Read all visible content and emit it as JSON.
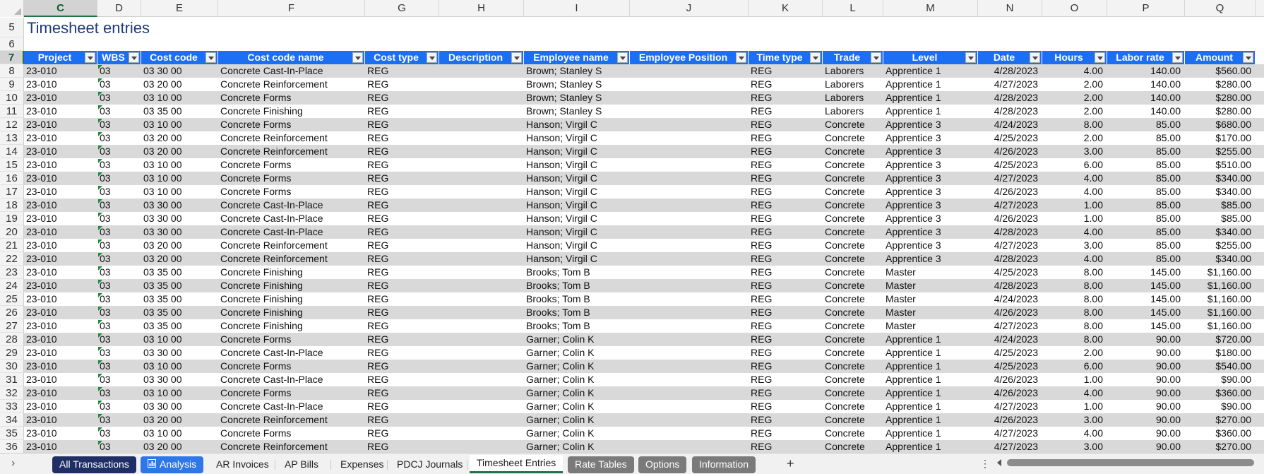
{
  "sheet": {
    "title": "Timesheet entries",
    "columns": [
      {
        "letter": "C",
        "selected": true
      },
      {
        "letter": "D"
      },
      {
        "letter": "E"
      },
      {
        "letter": "F"
      },
      {
        "letter": "G"
      },
      {
        "letter": "H"
      },
      {
        "letter": "I"
      },
      {
        "letter": "J"
      },
      {
        "letter": "K"
      },
      {
        "letter": "L"
      },
      {
        "letter": "M"
      },
      {
        "letter": "N"
      },
      {
        "letter": "O"
      },
      {
        "letter": "P"
      },
      {
        "letter": "Q"
      }
    ],
    "row_numbers_top": [
      "5",
      "6",
      "7"
    ],
    "headers": [
      "Project",
      "WBS",
      "Cost code",
      "Cost code name",
      "Cost type",
      "Description",
      "Employee name",
      "Employee Position",
      "Time type",
      "Trade",
      "Level",
      "Date",
      "Hours",
      "Labor rate",
      "Amount"
    ],
    "rows": [
      {
        "n": "8",
        "cells": [
          "23-010",
          "03",
          "03 30 00",
          "Concrete Cast-In-Place",
          "REG",
          "",
          "Brown; Stanley S",
          "",
          "REG",
          "Laborers",
          "Apprentice 1",
          "4/28/2023",
          "4.00",
          "140.00",
          "$560.00"
        ]
      },
      {
        "n": "9",
        "cells": [
          "23-010",
          "03",
          "03 20 00",
          "Concrete Reinforcement",
          "REG",
          "",
          "Brown; Stanley S",
          "",
          "REG",
          "Laborers",
          "Apprentice 1",
          "4/27/2023",
          "2.00",
          "140.00",
          "$280.00"
        ]
      },
      {
        "n": "10",
        "cells": [
          "23-010",
          "03",
          "03 10 00",
          "Concrete Forms",
          "REG",
          "",
          "Brown; Stanley S",
          "",
          "REG",
          "Laborers",
          "Apprentice 1",
          "4/28/2023",
          "2.00",
          "140.00",
          "$280.00"
        ]
      },
      {
        "n": "11",
        "cells": [
          "23-010",
          "03",
          "03 35 00",
          "Concrete Finishing",
          "REG",
          "",
          "Brown; Stanley S",
          "",
          "REG",
          "Laborers",
          "Apprentice 1",
          "4/28/2023",
          "2.00",
          "140.00",
          "$280.00"
        ]
      },
      {
        "n": "12",
        "cells": [
          "23-010",
          "03",
          "03 10 00",
          "Concrete Forms",
          "REG",
          "",
          "Hanson; Virgil C",
          "",
          "REG",
          "Concrete",
          "Apprentice 3",
          "4/24/2023",
          "8.00",
          "85.00",
          "$680.00"
        ]
      },
      {
        "n": "13",
        "cells": [
          "23-010",
          "03",
          "03 20 00",
          "Concrete Reinforcement",
          "REG",
          "",
          "Hanson; Virgil C",
          "",
          "REG",
          "Concrete",
          "Apprentice 3",
          "4/25/2023",
          "2.00",
          "85.00",
          "$170.00"
        ]
      },
      {
        "n": "14",
        "cells": [
          "23-010",
          "03",
          "03 20 00",
          "Concrete Reinforcement",
          "REG",
          "",
          "Hanson; Virgil C",
          "",
          "REG",
          "Concrete",
          "Apprentice 3",
          "4/26/2023",
          "3.00",
          "85.00",
          "$255.00"
        ]
      },
      {
        "n": "15",
        "cells": [
          "23-010",
          "03",
          "03 10 00",
          "Concrete Forms",
          "REG",
          "",
          "Hanson; Virgil C",
          "",
          "REG",
          "Concrete",
          "Apprentice 3",
          "4/25/2023",
          "6.00",
          "85.00",
          "$510.00"
        ]
      },
      {
        "n": "16",
        "cells": [
          "23-010",
          "03",
          "03 10 00",
          "Concrete Forms",
          "REG",
          "",
          "Hanson; Virgil C",
          "",
          "REG",
          "Concrete",
          "Apprentice 3",
          "4/27/2023",
          "4.00",
          "85.00",
          "$340.00"
        ]
      },
      {
        "n": "17",
        "cells": [
          "23-010",
          "03",
          "03 10 00",
          "Concrete Forms",
          "REG",
          "",
          "Hanson; Virgil C",
          "",
          "REG",
          "Concrete",
          "Apprentice 3",
          "4/26/2023",
          "4.00",
          "85.00",
          "$340.00"
        ]
      },
      {
        "n": "18",
        "cells": [
          "23-010",
          "03",
          "03 30 00",
          "Concrete Cast-In-Place",
          "REG",
          "",
          "Hanson; Virgil C",
          "",
          "REG",
          "Concrete",
          "Apprentice 3",
          "4/27/2023",
          "1.00",
          "85.00",
          "$85.00"
        ]
      },
      {
        "n": "19",
        "cells": [
          "23-010",
          "03",
          "03 30 00",
          "Concrete Cast-In-Place",
          "REG",
          "",
          "Hanson; Virgil C",
          "",
          "REG",
          "Concrete",
          "Apprentice 3",
          "4/26/2023",
          "1.00",
          "85.00",
          "$85.00"
        ]
      },
      {
        "n": "20",
        "cells": [
          "23-010",
          "03",
          "03 30 00",
          "Concrete Cast-In-Place",
          "REG",
          "",
          "Hanson; Virgil C",
          "",
          "REG",
          "Concrete",
          "Apprentice 3",
          "4/28/2023",
          "4.00",
          "85.00",
          "$340.00"
        ]
      },
      {
        "n": "21",
        "cells": [
          "23-010",
          "03",
          "03 20 00",
          "Concrete Reinforcement",
          "REG",
          "",
          "Hanson; Virgil C",
          "",
          "REG",
          "Concrete",
          "Apprentice 3",
          "4/27/2023",
          "3.00",
          "85.00",
          "$255.00"
        ]
      },
      {
        "n": "22",
        "cells": [
          "23-010",
          "03",
          "03 20 00",
          "Concrete Reinforcement",
          "REG",
          "",
          "Hanson; Virgil C",
          "",
          "REG",
          "Concrete",
          "Apprentice 3",
          "4/28/2023",
          "4.00",
          "85.00",
          "$340.00"
        ]
      },
      {
        "n": "23",
        "cells": [
          "23-010",
          "03",
          "03 35 00",
          "Concrete Finishing",
          "REG",
          "",
          "Brooks; Tom B",
          "",
          "REG",
          "Concrete",
          "Master",
          "4/25/2023",
          "8.00",
          "145.00",
          "$1,160.00"
        ]
      },
      {
        "n": "24",
        "cells": [
          "23-010",
          "03",
          "03 35 00",
          "Concrete Finishing",
          "REG",
          "",
          "Brooks; Tom B",
          "",
          "REG",
          "Concrete",
          "Master",
          "4/28/2023",
          "8.00",
          "145.00",
          "$1,160.00"
        ]
      },
      {
        "n": "25",
        "cells": [
          "23-010",
          "03",
          "03 35 00",
          "Concrete Finishing",
          "REG",
          "",
          "Brooks; Tom B",
          "",
          "REG",
          "Concrete",
          "Master",
          "4/24/2023",
          "8.00",
          "145.00",
          "$1,160.00"
        ]
      },
      {
        "n": "26",
        "cells": [
          "23-010",
          "03",
          "03 35 00",
          "Concrete Finishing",
          "REG",
          "",
          "Brooks; Tom B",
          "",
          "REG",
          "Concrete",
          "Master",
          "4/26/2023",
          "8.00",
          "145.00",
          "$1,160.00"
        ]
      },
      {
        "n": "27",
        "cells": [
          "23-010",
          "03",
          "03 35 00",
          "Concrete Finishing",
          "REG",
          "",
          "Brooks; Tom B",
          "",
          "REG",
          "Concrete",
          "Master",
          "4/27/2023",
          "8.00",
          "145.00",
          "$1,160.00"
        ]
      },
      {
        "n": "28",
        "cells": [
          "23-010",
          "03",
          "03 10 00",
          "Concrete Forms",
          "REG",
          "",
          "Garner; Colin K",
          "",
          "REG",
          "Concrete",
          "Apprentice 1",
          "4/24/2023",
          "8.00",
          "90.00",
          "$720.00"
        ]
      },
      {
        "n": "29",
        "cells": [
          "23-010",
          "03",
          "03 30 00",
          "Concrete Cast-In-Place",
          "REG",
          "",
          "Garner; Colin K",
          "",
          "REG",
          "Concrete",
          "Apprentice 1",
          "4/25/2023",
          "2.00",
          "90.00",
          "$180.00"
        ]
      },
      {
        "n": "30",
        "cells": [
          "23-010",
          "03",
          "03 10 00",
          "Concrete Forms",
          "REG",
          "",
          "Garner; Colin K",
          "",
          "REG",
          "Concrete",
          "Apprentice 1",
          "4/25/2023",
          "6.00",
          "90.00",
          "$540.00"
        ]
      },
      {
        "n": "31",
        "cells": [
          "23-010",
          "03",
          "03 30 00",
          "Concrete Cast-In-Place",
          "REG",
          "",
          "Garner; Colin K",
          "",
          "REG",
          "Concrete",
          "Apprentice 1",
          "4/26/2023",
          "1.00",
          "90.00",
          "$90.00"
        ]
      },
      {
        "n": "32",
        "cells": [
          "23-010",
          "03",
          "03 10 00",
          "Concrete Forms",
          "REG",
          "",
          "Garner; Colin K",
          "",
          "REG",
          "Concrete",
          "Apprentice 1",
          "4/26/2023",
          "4.00",
          "90.00",
          "$360.00"
        ]
      },
      {
        "n": "33",
        "cells": [
          "23-010",
          "03",
          "03 30 00",
          "Concrete Cast-In-Place",
          "REG",
          "",
          "Garner; Colin K",
          "",
          "REG",
          "Concrete",
          "Apprentice 1",
          "4/27/2023",
          "1.00",
          "90.00",
          "$90.00"
        ]
      },
      {
        "n": "34",
        "cells": [
          "23-010",
          "03",
          "03 20 00",
          "Concrete Reinforcement",
          "REG",
          "",
          "Garner; Colin K",
          "",
          "REG",
          "Concrete",
          "Apprentice 1",
          "4/26/2023",
          "3.00",
          "90.00",
          "$270.00"
        ]
      },
      {
        "n": "35",
        "cells": [
          "23-010",
          "03",
          "03 10 00",
          "Concrete Forms",
          "REG",
          "",
          "Garner; Colin K",
          "",
          "REG",
          "Concrete",
          "Apprentice 1",
          "4/27/2023",
          "4.00",
          "90.00",
          "$360.00"
        ]
      },
      {
        "n": "36",
        "cells": [
          "23-010",
          "03",
          "03 20 00",
          "Concrete Reinforcement",
          "REG",
          "",
          "Garner; Colin K",
          "",
          "REG",
          "Concrete",
          "Apprentice 1",
          "4/27/2023",
          "3.00",
          "90.00",
          "$270.00"
        ]
      }
    ]
  },
  "tabs": [
    {
      "label": "All Transactions",
      "style": "dark"
    },
    {
      "label": "Analysis",
      "style": "blue",
      "icon": "chart-icon"
    },
    {
      "label": "AR Invoices",
      "style": "normal"
    },
    {
      "label": "AP Bills",
      "style": "normal"
    },
    {
      "label": "Expenses",
      "style": "normal"
    },
    {
      "label": "PDCJ Journals",
      "style": "normal"
    },
    {
      "label": "Timesheet Entries",
      "style": "active"
    },
    {
      "label": "Rate Tables",
      "style": "gray"
    },
    {
      "label": "Options",
      "style": "gray"
    },
    {
      "label": "Information",
      "style": "gray"
    }
  ],
  "tabbar": {
    "add_label": "+",
    "more_label": "⋮"
  },
  "colors": {
    "header_blue": "#1c6ef2",
    "alt_row": "#d9d9d9",
    "title": "#1f3b7a",
    "tab_dark": "#1f2f66",
    "tab_blue": "#2f76e6",
    "tab_gray": "#7a7a7a"
  }
}
